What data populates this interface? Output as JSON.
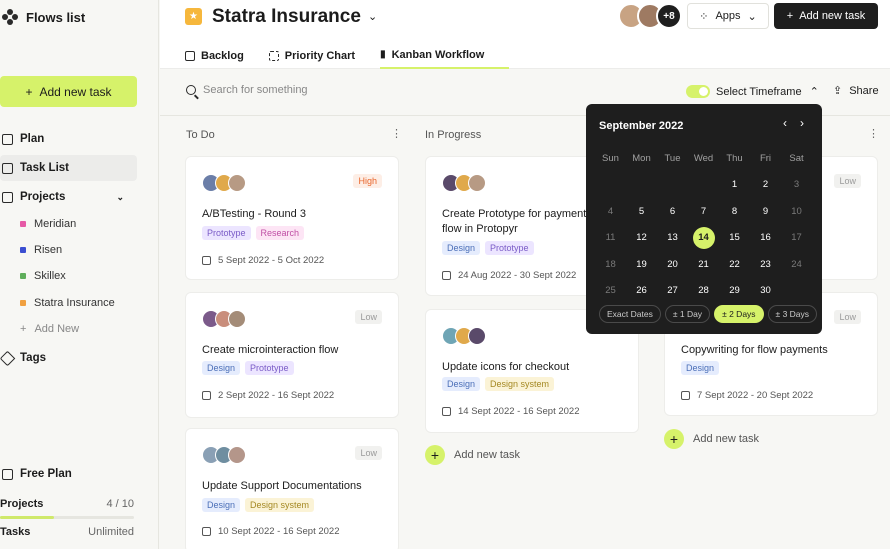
{
  "sidebar": {
    "title": "Flows list",
    "add_task": "Add new task",
    "nav": [
      {
        "label": "Plan"
      },
      {
        "label": "Task List"
      },
      {
        "label": "Projects"
      }
    ],
    "projects": [
      {
        "label": "Meridian",
        "color": "#e65aa6"
      },
      {
        "label": "Risen",
        "color": "#3b4fd1"
      },
      {
        "label": "Skillex",
        "color": "#5fae5b"
      },
      {
        "label": "Statra Insurance",
        "color": "#f0a040"
      }
    ],
    "add_new": "Add New",
    "tags": "Tags",
    "plan": "Free Plan",
    "projects_metric": {
      "label": "Projects",
      "value": "4 / 10",
      "fraction": 0.4
    },
    "tasks_metric": {
      "label": "Tasks",
      "value": "Unlimited"
    }
  },
  "header": {
    "workspace": "Statra Insurance",
    "more_count": "+8",
    "apps": "Apps",
    "add_task": "Add new task",
    "tabs": [
      "Backlog",
      "Priority Chart",
      "Kanban Workflow"
    ]
  },
  "toolbar": {
    "search_placeholder": "Search for something",
    "timeframe": "Select Timeframe",
    "share": "Share"
  },
  "columns": [
    {
      "title": "To Do"
    },
    {
      "title": "In Progress"
    }
  ],
  "cards": {
    "todo": [
      {
        "priority": "High",
        "title": "A/BTesting - Round 3",
        "tags": [
          "Prototype",
          "Research"
        ],
        "date": "5 Sept 2022 - 5 Oct 2022"
      },
      {
        "priority": "Low",
        "title": "Create microinteraction flow",
        "tags": [
          "Design",
          "Prototype"
        ],
        "date": "2 Sept 2022 - 16 Sept 2022"
      },
      {
        "priority": "Low",
        "title": "Update Support Documentations",
        "tags": [
          "Design",
          "Design system"
        ],
        "date": "10 Sept 2022 - 16 Sept 2022"
      }
    ],
    "progress": [
      {
        "title": "Create Prototype for payments flow in Protopyr",
        "tags": [
          "Design",
          "Prototype"
        ],
        "date": "24 Aug 2022 - 30 Sept 2022"
      },
      {
        "title": "Update icons for checkout",
        "tags": [
          "Design",
          "Design system"
        ],
        "date": "14 Sept 2022 - 16 Sept 2022"
      }
    ],
    "third": [
      {
        "priority": "Low"
      },
      {
        "priority": "Low",
        "title": "Copywriting for flow payments",
        "tags": [
          "Design"
        ],
        "date": "7 Sept 2022 - 20 Sept 2022"
      }
    ]
  },
  "add_column_task": "Add new task",
  "calendar": {
    "month": "September 2022",
    "days_of_week": [
      "Sun",
      "Mon",
      "Tue",
      "Wed",
      "Thu",
      "Fri",
      "Sat"
    ],
    "weeks": [
      [
        "",
        "",
        "",
        "",
        "1",
        "2",
        "3"
      ],
      [
        "4",
        "5",
        "6",
        "7",
        "8",
        "9",
        "10"
      ],
      [
        "11",
        "12",
        "13",
        "14",
        "15",
        "16",
        "17"
      ],
      [
        "18",
        "19",
        "20",
        "21",
        "22",
        "23",
        "24"
      ],
      [
        "25",
        "26",
        "27",
        "28",
        "29",
        "30",
        ""
      ]
    ],
    "selected": "14",
    "ranges": [
      "Exact Dates",
      "± 1 Day",
      "± 2 Days",
      "± 3 Days"
    ],
    "active_range": "± 2 Days"
  }
}
